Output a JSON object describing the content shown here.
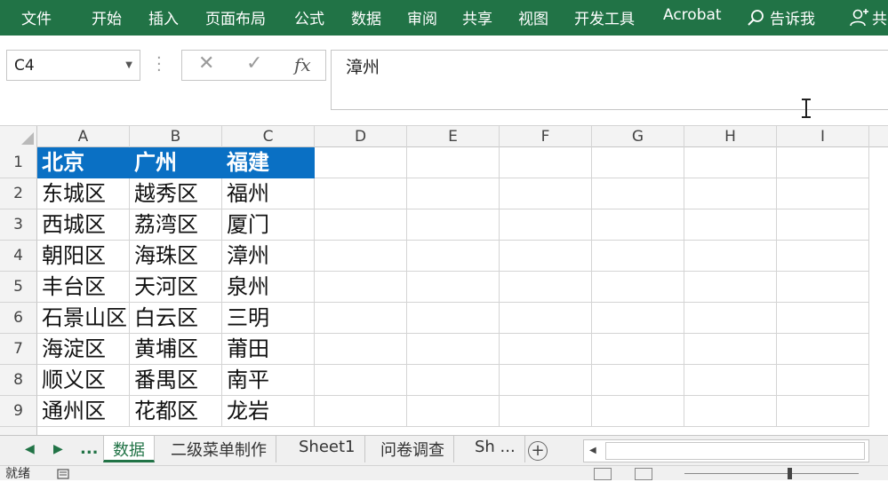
{
  "ribbon": {
    "tabs": [
      "文件",
      "开始",
      "插入",
      "页面布局",
      "公式",
      "数据",
      "审阅",
      "共享",
      "视图",
      "开发工具",
      "Acrobat"
    ],
    "tell_me": "告诉我",
    "share": "共",
    "bg_color": "#217346"
  },
  "formula_bar": {
    "name_box": "C4",
    "cancel_icon": "✕",
    "enter_icon": "✓",
    "fx_label": "fx",
    "value": "漳州"
  },
  "grid": {
    "columns": [
      "A",
      "B",
      "C",
      "D",
      "E",
      "F",
      "G",
      "H",
      "I"
    ],
    "rows": [
      "1",
      "2",
      "3",
      "4",
      "5",
      "6",
      "7",
      "8",
      "9"
    ],
    "cells": [
      [
        "北京",
        "广州",
        "福建"
      ],
      [
        "东城区",
        "越秀区",
        "福州"
      ],
      [
        "西城区",
        "荔湾区",
        "厦门"
      ],
      [
        "朝阳区",
        "海珠区",
        "漳州"
      ],
      [
        "丰台区",
        "天河区",
        "泉州"
      ],
      [
        "石景山区",
        "白云区",
        "三明"
      ],
      [
        "海淀区",
        "黄埔区",
        "莆田"
      ],
      [
        "顺义区",
        "番禺区",
        "南平"
      ],
      [
        "通州区",
        "花都区",
        "龙岩"
      ]
    ],
    "header_fill": "#0a70c4",
    "selected_cell": "C4"
  },
  "sheet_tabs": {
    "prev_icon": "◀",
    "next_icon": "▶",
    "ellipsis": "...",
    "tabs": [
      "数据",
      "二级菜单制作",
      "Sheet1",
      "问卷调查",
      "Sh ..."
    ],
    "active": "数据",
    "add_icon": "+"
  },
  "status_bar": {
    "ready": "就绪"
  }
}
